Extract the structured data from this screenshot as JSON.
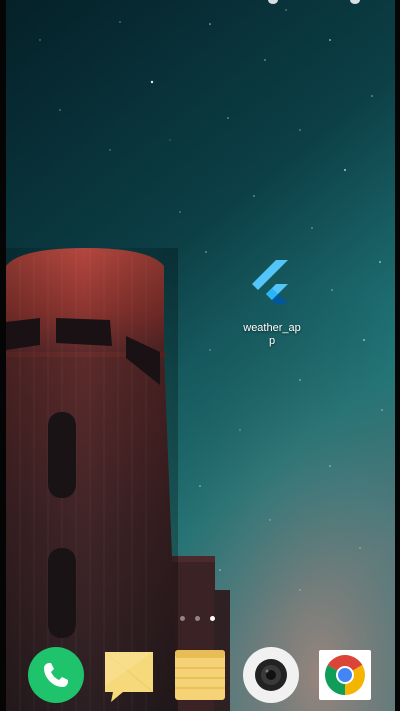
{
  "home_screen": {
    "app": {
      "label": "weather_ap\np",
      "icon": "flutter-icon"
    },
    "page_indicator": {
      "count": 3,
      "active_index": 2
    }
  },
  "dock": {
    "apps": [
      {
        "icon": "phone-icon",
        "color": "#1fc36b"
      },
      {
        "icon": "messages-icon",
        "color": "#f6d97b"
      },
      {
        "icon": "notes-icon",
        "color": "#f5d275"
      },
      {
        "icon": "camera-icon",
        "color": "#f1f1f1"
      },
      {
        "icon": "chrome-icon",
        "color": "#ffffff"
      }
    ]
  },
  "colors": {
    "sky_top": "#06262e",
    "sky_bottom": "#2a8a8a",
    "tower_red": "#a03a33",
    "flutter_light": "#54c5f8",
    "flutter_dark": "#01579b"
  }
}
